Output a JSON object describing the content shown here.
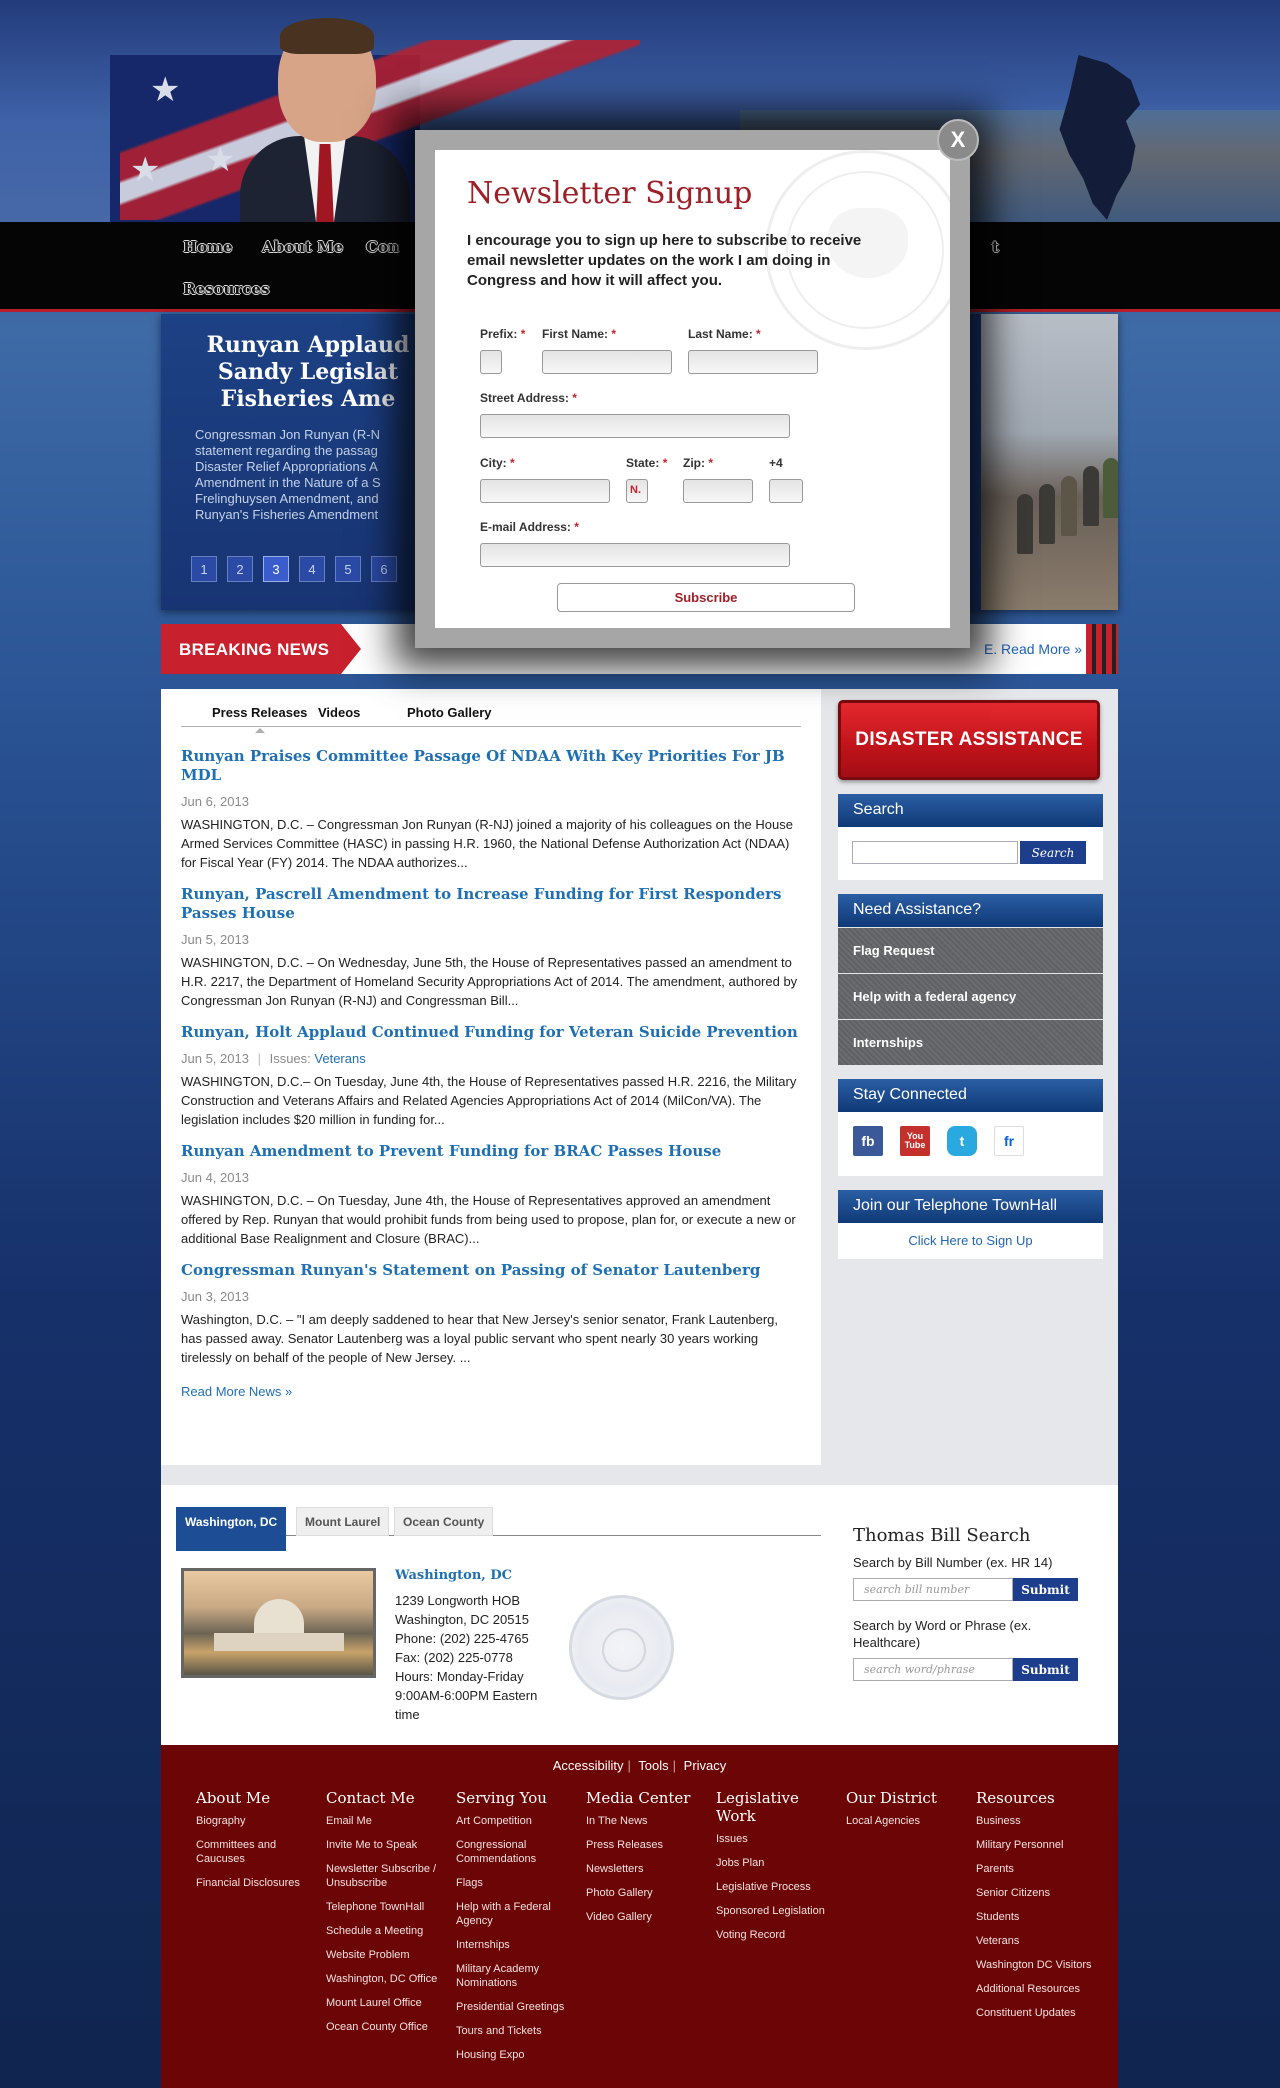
{
  "nav": {
    "items": [
      {
        "label": "Home"
      },
      {
        "label": "About Me"
      },
      {
        "label": "Con"
      },
      {
        "label": "t"
      },
      {
        "label": "Resources"
      }
    ]
  },
  "feature": {
    "title": "Runyan Applaud Sandy Legislat Fisheries Ame",
    "description": "Congressman Jon Runyan (R-N statement regarding the passag Disaster Relief Appropriations A Amendment in the Nature of a S Frelinghuysen Amendment, and Runyan's Fisheries Amendment",
    "pages": [
      "1",
      "2",
      "3",
      "4",
      "5",
      "6"
    ],
    "active_page": 3
  },
  "breaking": {
    "label": "BREAKING NEWS",
    "more": "E. Read More »"
  },
  "tabs": [
    "Press Releases",
    "Videos",
    "Photo Gallery"
  ],
  "news": [
    {
      "title": "Runyan Praises Committee Passage Of NDAA With Key Priorities For JB MDL",
      "date": "Jun 6, 2013",
      "body": "WASHINGTON, D.C. – Congressman Jon Runyan (R-NJ) joined a majority of his colleagues on the House Armed Services Committee (HASC) in passing H.R. 1960, the National Defense Authorization Act (NDAA) for Fiscal Year (FY) 2014. The NDAA authorizes..."
    },
    {
      "title": "Runyan, Pascrell Amendment to Increase Funding for First Responders Passes House",
      "date": "Jun 5, 2013",
      "body": "WASHINGTON, D.C. – On Wednesday, June 5th, the House of Representatives passed an amendment to H.R. 2217, the Department of Homeland Security Appropriations Act of 2014.  The amendment, authored by Congressman Jon Runyan (R-NJ) and Congressman Bill..."
    },
    {
      "title": "Runyan, Holt Applaud Continued Funding for Veteran Suicide Prevention",
      "date": "Jun 5, 2013",
      "issues_label": "Issues:",
      "issue": "Veterans",
      "body": "WASHINGTON, D.C.– On Tuesday, June 4th, the House of Representatives passed H.R. 2216, the Military Construction and Veterans Affairs and Related Agencies Appropriations Act of 2014 (MilCon/VA). The legislation includes $20 million in funding for..."
    },
    {
      "title": "Runyan Amendment to Prevent Funding for BRAC Passes House",
      "date": "Jun 4, 2013",
      "body": "WASHINGTON, D.C. – On Tuesday, June 4th, the House of Representatives approved an amendment offered by Rep. Runyan that would prohibit funds from being used to propose, plan for, or execute a new or additional Base Realignment and Closure (BRAC)..."
    },
    {
      "title": "Congressman Runyan's Statement on Passing of Senator Lautenberg",
      "date": "Jun 3, 2013",
      "body": "Washington, D.C. – \"I am deeply saddened to hear that New Jersey's senior senator, Frank Lautenberg, has passed away. Senator Lautenberg was a loyal public servant who spent nearly 30 years working tirelessly on behalf of the people of New Jersey. ..."
    }
  ],
  "read_more_news": "Read More News »",
  "sidebar": {
    "disaster": "DISASTER ASSISTANCE",
    "search_head": "Search",
    "search_btn": "Search",
    "need_head": "Need Assistance?",
    "need_items": [
      "Flag Request",
      "Help with a federal agency",
      "Internships"
    ],
    "stay_head": "Stay Connected",
    "social": [
      {
        "icon": "facebook-icon",
        "label": "fb",
        "color": "#3b5998"
      },
      {
        "icon": "youtube-icon",
        "label": "You Tube",
        "color": "#c4302b"
      },
      {
        "icon": "twitter-icon",
        "label": "t",
        "color": "#2aa9e0"
      },
      {
        "icon": "flickr-icon",
        "label": "fr",
        "color": "#ffffff"
      }
    ],
    "townhall_head": "Join our Telephone TownHall",
    "townhall_link": "Click Here to Sign Up"
  },
  "offices": {
    "tabs": [
      "Washington, DC",
      "Mount Laurel",
      "Ocean County"
    ],
    "name": "Washington, DC",
    "lines": [
      "1239 Longworth HOB",
      "Washington, DC 20515",
      "Phone: (202) 225-4765",
      "Fax: (202) 225-0778",
      "Hours: Monday-Friday 9:00AM-6:00PM Eastern time"
    ]
  },
  "thomas": {
    "title": "Thomas Bill Search",
    "label1": "Search by Bill Number (ex. HR 14)",
    "ph1": "search bill number",
    "label2": "Search by Word or Phrase (ex. Healthcare)",
    "ph2": "search word/phrase",
    "submit": "Submit"
  },
  "footer": {
    "util": [
      "Accessibility",
      "Tools",
      "Privacy"
    ],
    "columns": [
      {
        "title": "About Me",
        "links": [
          "Biography",
          "Committees and Caucuses",
          "Financial Disclosures"
        ]
      },
      {
        "title": "Contact Me",
        "links": [
          "Email Me",
          "Invite Me to Speak",
          "Newsletter Subscribe / Unsubscribe",
          "Telephone TownHall",
          "Schedule a Meeting",
          "Website Problem",
          "Washington, DC Office",
          "Mount Laurel Office",
          "Ocean County Office"
        ]
      },
      {
        "title": "Serving You",
        "links": [
          "Art Competition",
          "Congressional Commendations",
          "Flags",
          "Help with a Federal Agency",
          "Internships",
          "Military Academy Nominations",
          "Presidential Greetings",
          "Tours and Tickets",
          "Housing Expo"
        ]
      },
      {
        "title": "Media Center",
        "links": [
          "In The News",
          "Press Releases",
          "Newsletters",
          "Photo Gallery",
          "Video Gallery"
        ]
      },
      {
        "title": "Legislative Work",
        "links": [
          "Issues",
          "Jobs Plan",
          "Legislative Process",
          "Sponsored Legislation",
          "Voting Record"
        ]
      },
      {
        "title": "Our District",
        "links": [
          "Local Agencies"
        ]
      },
      {
        "title": "Resources",
        "links": [
          "Business",
          "Military Personnel",
          "Parents",
          "Senior Citizens",
          "Students",
          "Veterans",
          "Washington DC Visitors",
          "Additional Resources",
          "Constituent Updates"
        ]
      }
    ]
  },
  "modal": {
    "close": "X",
    "title": "Newsletter Signup",
    "intro": "I encourage you to sign up here to subscribe to receive email newsletter updates on the work I am doing in Congress and how it will affect you.",
    "prefix": "Prefix:",
    "first_name": "First Name:",
    "last_name": "Last Name:",
    "street": "Street Address:",
    "city": "City:",
    "state": "State:",
    "state_value": "N.",
    "zip": "Zip:",
    "plus4": "+4",
    "email": "E-mail Address:",
    "required_mark": "*",
    "subscribe": "Subscribe"
  }
}
